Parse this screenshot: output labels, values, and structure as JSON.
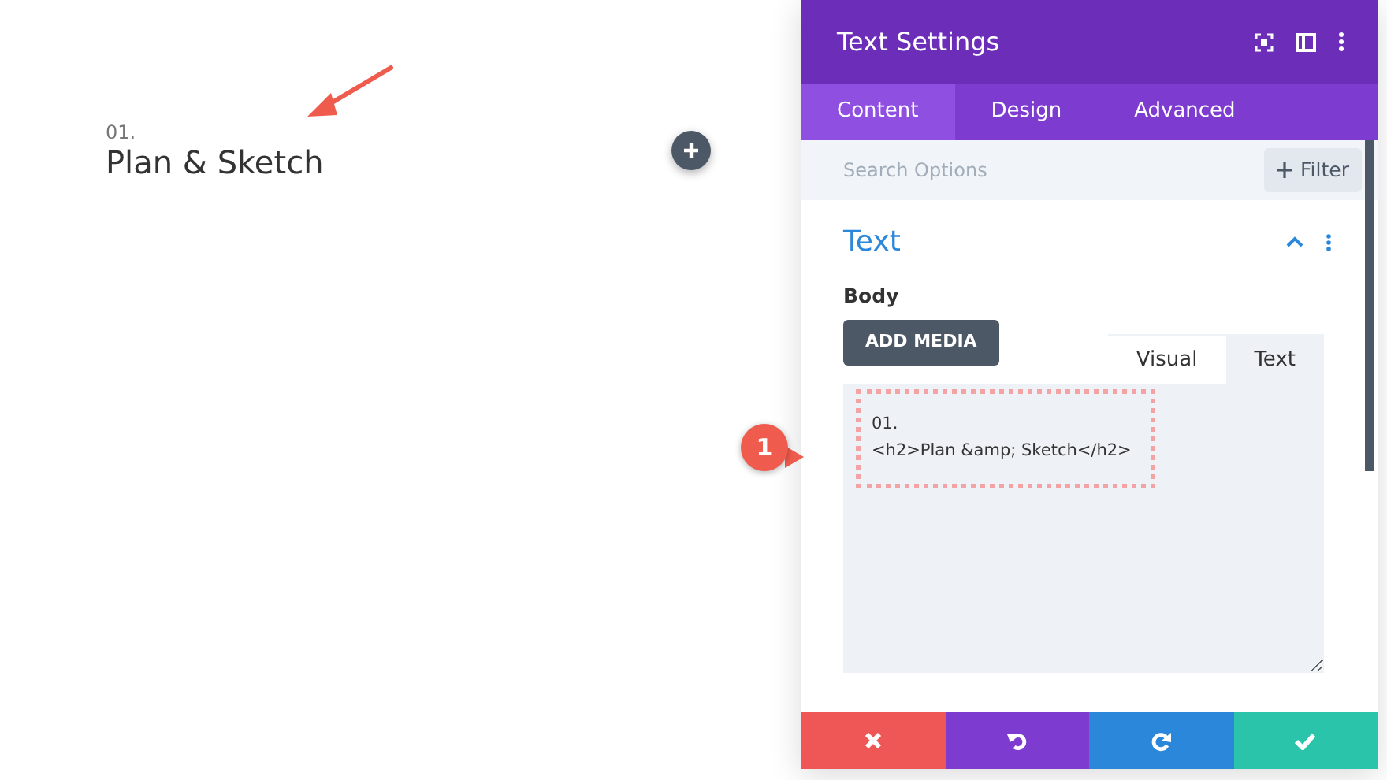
{
  "page": {
    "number": "01.",
    "heading": "Plan & Sketch"
  },
  "panel": {
    "title": "Text Settings",
    "tabs": [
      {
        "label": "Content",
        "selected": true
      },
      {
        "label": "Design",
        "selected": false
      },
      {
        "label": "Advanced",
        "selected": false
      }
    ],
    "search": {
      "placeholder": "Search Options"
    },
    "filter_button": "Filter",
    "section": {
      "title": "Text",
      "expanded": true
    },
    "field_label": "Body",
    "add_media": "ADD MEDIA",
    "editor_tabs": [
      {
        "label": "Visual",
        "selected": false
      },
      {
        "label": "Text",
        "selected": true
      }
    ],
    "editor_value": "01.\n<h2>Plan &amp; Sketch</h2>",
    "callout": "1",
    "actions": [
      {
        "kind": "cancel",
        "color": "#ef5656"
      },
      {
        "kind": "undo",
        "color": "#7e3bd0"
      },
      {
        "kind": "redo",
        "color": "#2b87da"
      },
      {
        "kind": "save",
        "color": "#29c4a9"
      }
    ]
  }
}
